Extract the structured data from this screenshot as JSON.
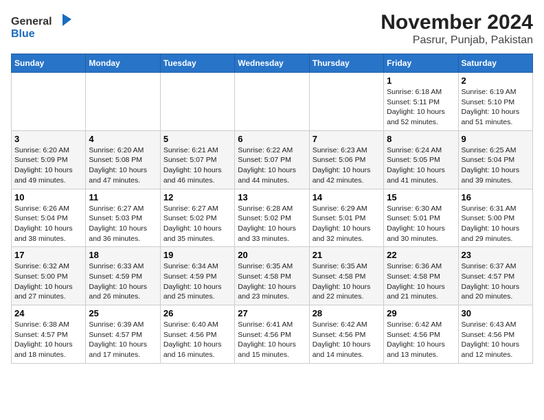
{
  "logo": {
    "line1": "General",
    "line2": "Blue"
  },
  "title": "November 2024",
  "subtitle": "Pasrur, Punjab, Pakistan",
  "days_of_week": [
    "Sunday",
    "Monday",
    "Tuesday",
    "Wednesday",
    "Thursday",
    "Friday",
    "Saturday"
  ],
  "weeks": [
    [
      {
        "day": "",
        "info": ""
      },
      {
        "day": "",
        "info": ""
      },
      {
        "day": "",
        "info": ""
      },
      {
        "day": "",
        "info": ""
      },
      {
        "day": "",
        "info": ""
      },
      {
        "day": "1",
        "info": "Sunrise: 6:18 AM\nSunset: 5:11 PM\nDaylight: 10 hours\nand 52 minutes."
      },
      {
        "day": "2",
        "info": "Sunrise: 6:19 AM\nSunset: 5:10 PM\nDaylight: 10 hours\nand 51 minutes."
      }
    ],
    [
      {
        "day": "3",
        "info": "Sunrise: 6:20 AM\nSunset: 5:09 PM\nDaylight: 10 hours\nand 49 minutes."
      },
      {
        "day": "4",
        "info": "Sunrise: 6:20 AM\nSunset: 5:08 PM\nDaylight: 10 hours\nand 47 minutes."
      },
      {
        "day": "5",
        "info": "Sunrise: 6:21 AM\nSunset: 5:07 PM\nDaylight: 10 hours\nand 46 minutes."
      },
      {
        "day": "6",
        "info": "Sunrise: 6:22 AM\nSunset: 5:07 PM\nDaylight: 10 hours\nand 44 minutes."
      },
      {
        "day": "7",
        "info": "Sunrise: 6:23 AM\nSunset: 5:06 PM\nDaylight: 10 hours\nand 42 minutes."
      },
      {
        "day": "8",
        "info": "Sunrise: 6:24 AM\nSunset: 5:05 PM\nDaylight: 10 hours\nand 41 minutes."
      },
      {
        "day": "9",
        "info": "Sunrise: 6:25 AM\nSunset: 5:04 PM\nDaylight: 10 hours\nand 39 minutes."
      }
    ],
    [
      {
        "day": "10",
        "info": "Sunrise: 6:26 AM\nSunset: 5:04 PM\nDaylight: 10 hours\nand 38 minutes."
      },
      {
        "day": "11",
        "info": "Sunrise: 6:27 AM\nSunset: 5:03 PM\nDaylight: 10 hours\nand 36 minutes."
      },
      {
        "day": "12",
        "info": "Sunrise: 6:27 AM\nSunset: 5:02 PM\nDaylight: 10 hours\nand 35 minutes."
      },
      {
        "day": "13",
        "info": "Sunrise: 6:28 AM\nSunset: 5:02 PM\nDaylight: 10 hours\nand 33 minutes."
      },
      {
        "day": "14",
        "info": "Sunrise: 6:29 AM\nSunset: 5:01 PM\nDaylight: 10 hours\nand 32 minutes."
      },
      {
        "day": "15",
        "info": "Sunrise: 6:30 AM\nSunset: 5:01 PM\nDaylight: 10 hours\nand 30 minutes."
      },
      {
        "day": "16",
        "info": "Sunrise: 6:31 AM\nSunset: 5:00 PM\nDaylight: 10 hours\nand 29 minutes."
      }
    ],
    [
      {
        "day": "17",
        "info": "Sunrise: 6:32 AM\nSunset: 5:00 PM\nDaylight: 10 hours\nand 27 minutes."
      },
      {
        "day": "18",
        "info": "Sunrise: 6:33 AM\nSunset: 4:59 PM\nDaylight: 10 hours\nand 26 minutes."
      },
      {
        "day": "19",
        "info": "Sunrise: 6:34 AM\nSunset: 4:59 PM\nDaylight: 10 hours\nand 25 minutes."
      },
      {
        "day": "20",
        "info": "Sunrise: 6:35 AM\nSunset: 4:58 PM\nDaylight: 10 hours\nand 23 minutes."
      },
      {
        "day": "21",
        "info": "Sunrise: 6:35 AM\nSunset: 4:58 PM\nDaylight: 10 hours\nand 22 minutes."
      },
      {
        "day": "22",
        "info": "Sunrise: 6:36 AM\nSunset: 4:58 PM\nDaylight: 10 hours\nand 21 minutes."
      },
      {
        "day": "23",
        "info": "Sunrise: 6:37 AM\nSunset: 4:57 PM\nDaylight: 10 hours\nand 20 minutes."
      }
    ],
    [
      {
        "day": "24",
        "info": "Sunrise: 6:38 AM\nSunset: 4:57 PM\nDaylight: 10 hours\nand 18 minutes."
      },
      {
        "day": "25",
        "info": "Sunrise: 6:39 AM\nSunset: 4:57 PM\nDaylight: 10 hours\nand 17 minutes."
      },
      {
        "day": "26",
        "info": "Sunrise: 6:40 AM\nSunset: 4:56 PM\nDaylight: 10 hours\nand 16 minutes."
      },
      {
        "day": "27",
        "info": "Sunrise: 6:41 AM\nSunset: 4:56 PM\nDaylight: 10 hours\nand 15 minutes."
      },
      {
        "day": "28",
        "info": "Sunrise: 6:42 AM\nSunset: 4:56 PM\nDaylight: 10 hours\nand 14 minutes."
      },
      {
        "day": "29",
        "info": "Sunrise: 6:42 AM\nSunset: 4:56 PM\nDaylight: 10 hours\nand 13 minutes."
      },
      {
        "day": "30",
        "info": "Sunrise: 6:43 AM\nSunset: 4:56 PM\nDaylight: 10 hours\nand 12 minutes."
      }
    ]
  ]
}
